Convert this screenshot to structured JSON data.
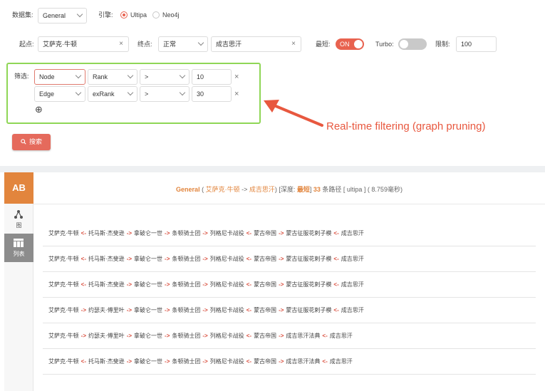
{
  "query": {
    "dataset_label": "数据集:",
    "dataset_value": "General",
    "engine_label": "引擎:",
    "engine_options": [
      "Ultipa",
      "Neo4j"
    ],
    "engine_selected": "Ultipa",
    "start_label": "起点:",
    "start_value": "艾萨克·牛顿",
    "end_label": "终点:",
    "end_mode": "正常",
    "end_value": "成吉思汗",
    "shortest_label": "最短:",
    "shortest_toggle": "ON",
    "turbo_label": "Turbo:",
    "limit_label": "限制:",
    "limit_value": "100",
    "clear_symbol": "×"
  },
  "filter": {
    "label": "筛选:",
    "rows": [
      {
        "type": "Node",
        "field": "Rank",
        "op": ">",
        "value": "10",
        "remove": "×"
      },
      {
        "type": "Edge",
        "field": "exRank",
        "op": ">",
        "value": "30",
        "remove": "×"
      }
    ],
    "add_symbol": "⊕"
  },
  "search_button": "搜索",
  "annotation": "Real-time filtering (graph pruning)",
  "sidebar": {
    "logo": "AB",
    "items": [
      {
        "label": "图",
        "icon": "graph-icon"
      },
      {
        "label": "列表",
        "icon": "table-icon"
      }
    ]
  },
  "summary": {
    "dataset": "General",
    "open": " ( ",
    "start": "艾萨克·牛顿",
    "arrow": " -> ",
    "end": "成吉思汗",
    "depth_prefix": ") [深度: ",
    "depth": "最短",
    "depth_suffix": "] ",
    "count": "33",
    "count_suffix": " 条路径 [ ultipa ] ( 8.759毫秒)"
  },
  "paths": [
    [
      "艾萨克·牛顿",
      "<-",
      "托马斯·杰斐逊",
      "->",
      "拿破仑一世",
      "->",
      "条顿骑士团",
      "->",
      "列格尼卡战役",
      "<-",
      "蒙古帝国",
      "->",
      "蒙古征服花剌子模",
      "<-",
      "成吉思汗"
    ],
    [
      "艾萨克·牛顿",
      "<-",
      "托马斯·杰斐逊",
      "->",
      "拿破仑一世",
      "->",
      "条顿骑士团",
      "->",
      "列格尼卡战役",
      "<-",
      "蒙古帝国",
      "->",
      "蒙古征服花剌子模",
      "<-",
      "成吉思汗"
    ],
    [
      "艾萨克·牛顿",
      "<-",
      "托马斯·杰斐逊",
      "->",
      "拿破仑一世",
      "->",
      "条顿骑士团",
      "->",
      "列格尼卡战役",
      "<-",
      "蒙古帝国",
      "->",
      "蒙古征服花剌子模",
      "<-",
      "成吉思汗"
    ],
    [
      "艾萨克·牛顿",
      "->",
      "约瑟夫·傅里叶",
      "->",
      "拿破仑一世",
      "->",
      "条顿骑士团",
      "->",
      "列格尼卡战役",
      "<-",
      "蒙古帝国",
      "->",
      "蒙古征服花剌子模",
      "<-",
      "成吉思汗"
    ],
    [
      "艾萨克·牛顿",
      "->",
      "约瑟夫·傅里叶",
      "->",
      "拿破仑一世",
      "->",
      "条顿骑士团",
      "->",
      "列格尼卡战役",
      "<-",
      "蒙古帝国",
      "->",
      "成吉思汗法典",
      "<-",
      "成吉思汗"
    ],
    [
      "艾萨克·牛顿",
      "<-",
      "托马斯·杰斐逊",
      "->",
      "拿破仑一世",
      "->",
      "条顿骑士团",
      "->",
      "列格尼卡战役",
      "<-",
      "蒙古帝国",
      "->",
      "成吉思汗法典",
      "<-",
      "成吉思汗"
    ]
  ]
}
